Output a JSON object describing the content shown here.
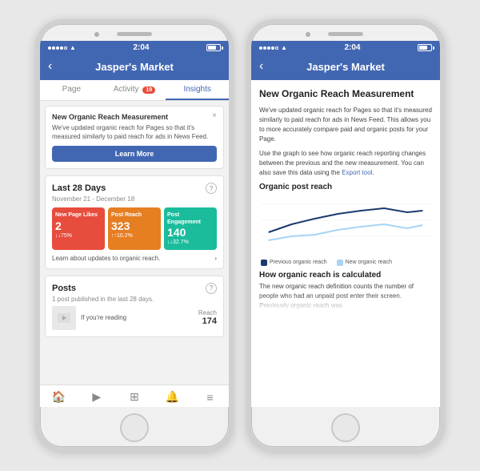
{
  "phones": [
    {
      "id": "phone-left",
      "statusBar": {
        "time": "2:04",
        "signal": "●●●●",
        "wifi": "WiFi",
        "batteryLevel": "70%"
      },
      "navBar": {
        "title": "Jasper's Market",
        "backLabel": "‹"
      },
      "tabs": [
        {
          "label": "Page",
          "active": false,
          "badge": null
        },
        {
          "label": "Activity",
          "active": false,
          "badge": "19"
        },
        {
          "label": "Insights",
          "active": true,
          "badge": null
        }
      ],
      "notification": {
        "title": "New Organic Reach Measurement",
        "text": "We've updated organic reach for Pages so that it's measured similarly to paid reach for ads in News Feed.",
        "learnMoreLabel": "Learn More",
        "closeLabel": "×"
      },
      "stats": {
        "sectionTitle": "Last 28 Days",
        "dateRange": "November 21 - December 18",
        "items": [
          {
            "label": "New Page Likes",
            "value": "2",
            "change": "↓75%",
            "color": "red"
          },
          {
            "label": "Post Reach",
            "value": "323",
            "change": "↑10.2%",
            "color": "orange"
          },
          {
            "label": "Post Engagement",
            "value": "140",
            "change": "↓32.7%",
            "color": "teal"
          }
        ],
        "organicLink": "Learn about updates to organic reach."
      },
      "posts": {
        "sectionTitle": "Posts",
        "subtitle": "1 post published in the last 28 days.",
        "item": {
          "description": "If you're reading",
          "reachLabel": "Reach",
          "reachValue": "174"
        }
      },
      "bottomNav": [
        "🏠",
        "▶",
        "⊞",
        "🔔",
        "≡"
      ]
    },
    {
      "id": "phone-right",
      "statusBar": {
        "time": "2:04"
      },
      "navBar": {
        "title": "Jasper's Market",
        "backLabel": "‹"
      },
      "article": {
        "title": "New Organic Reach Measurement",
        "paragraphs": [
          "We've updated organic reach for Pages so that it's measured similarly to paid reach for ads in News Feed. This allows you to more accurately compare paid and organic posts for your Page.",
          "Use the graph to see how organic reach reporting changes between the previous and the new measurement. You can also save this data using the Export tool."
        ],
        "exportLink": "Export tool",
        "chartTitle": "Organic post reach",
        "legend": [
          {
            "label": "Previous organic reach",
            "color": "#1a3a6e"
          },
          {
            "label": "New organic reach",
            "color": "#a8d4f5"
          }
        ],
        "bottomTitle": "How organic reach is calculated",
        "bottomText": "The new organic reach definition counts the number of people who had an unpaid post enter their screen. Previously organic reach was"
      }
    }
  ]
}
